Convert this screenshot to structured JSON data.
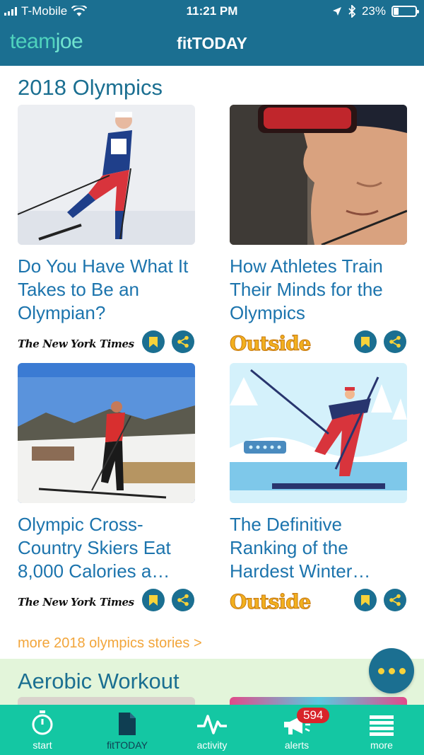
{
  "status_bar": {
    "carrier": "T-Mobile",
    "time": "11:21 PM",
    "battery": "23%",
    "battery_level": 0.23
  },
  "header": {
    "logo_team": "team",
    "logo_joe": "joe",
    "title": "fitTODAY"
  },
  "sections": [
    {
      "title": "2018 Olympics",
      "cards": [
        {
          "title": "Do You Have What It Takes to Be an Olympian?",
          "source": "The New York Times"
        },
        {
          "title": "How Athletes Train Their Minds for the Olympics",
          "source": "Outside"
        },
        {
          "title": "Olympic Cross-Country Skiers Eat 8,000 Calories a…",
          "source": "The New York Times"
        },
        {
          "title": "The Definitive Ranking of the Hardest Winter…",
          "source": "Outside"
        }
      ],
      "more_link": "more 2018 olympics stories >"
    },
    {
      "title": "Aerobic Workout"
    }
  ],
  "colors": {
    "header": "#1b6f91",
    "accent": "#1c74ad",
    "tabbar": "#14c7a3",
    "link": "#f2a53a",
    "badge": "#d8242a"
  },
  "tabbar": {
    "tabs": [
      {
        "label": "start",
        "icon": "stopwatch-icon"
      },
      {
        "label": "fitTODAY",
        "icon": "document-icon"
      },
      {
        "label": "activity",
        "icon": "pulse-icon"
      },
      {
        "label": "alerts",
        "icon": "megaphone-icon",
        "badge": "594"
      },
      {
        "label": "more",
        "icon": "menu-icon"
      }
    ],
    "active": "fitTODAY"
  }
}
